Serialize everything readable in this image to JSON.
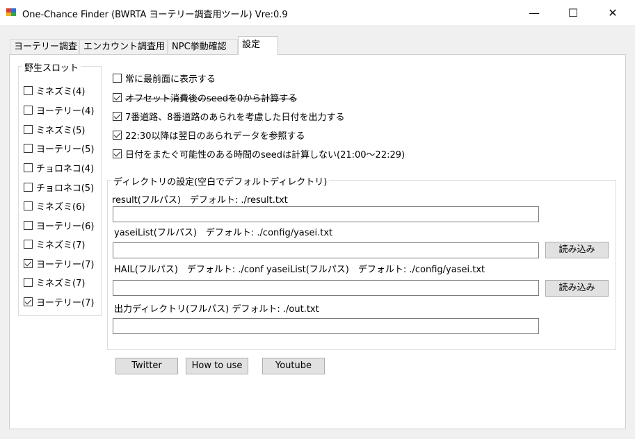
{
  "window": {
    "title": "One-Chance Finder (BWRTA ヨーテリー調査用ツール) Vre:0.9",
    "minimize": "—",
    "maximize": "☐",
    "close": "✕"
  },
  "tabs": [
    {
      "label": "ヨーテリー調査",
      "active": false
    },
    {
      "label": "エンカウント調査用",
      "active": false
    },
    {
      "label": "NPC挙動確認",
      "active": false
    },
    {
      "label": "設定",
      "active": true
    }
  ],
  "wild_slots": {
    "legend": "野生スロット",
    "items": [
      {
        "label": "ミネズミ(4)",
        "checked": false
      },
      {
        "label": "ヨーテリー(4)",
        "checked": false
      },
      {
        "label": "ミネズミ(5)",
        "checked": false
      },
      {
        "label": "ヨーテリー(5)",
        "checked": false
      },
      {
        "label": "チョロネコ(4)",
        "checked": false
      },
      {
        "label": "チョロネコ(5)",
        "checked": false
      },
      {
        "label": "ミネズミ(6)",
        "checked": false
      },
      {
        "label": "ヨーテリー(6)",
        "checked": false
      },
      {
        "label": "ミネズミ(7)",
        "checked": false
      },
      {
        "label": "ヨーテリー(7)",
        "checked": true
      },
      {
        "label": "ミネズミ(7)",
        "checked": false
      },
      {
        "label": "ヨーテリー(7)",
        "checked": true
      }
    ]
  },
  "options": [
    {
      "label": "常に最前面に表示する",
      "checked": false,
      "strike": false
    },
    {
      "label": "オフセット消費後のseedを0から計算する",
      "checked": true,
      "strike": true
    },
    {
      "label": "7番道路、8番道路のあられを考慮した日付を出力する",
      "checked": true,
      "strike": false
    },
    {
      "label": "22:30以降は翌日のあられデータを参照する",
      "checked": true,
      "strike": false
    },
    {
      "label": "日付をまたぐ可能性のある時間のseedは計算しない(21:00～22:29)",
      "checked": true,
      "strike": false
    }
  ],
  "directory": {
    "legend": "ディレクトリの設定(空白でデフォルトディレクトリ)",
    "result_label": "result(フルパス)　デフォルト: ./result.txt",
    "result_value": "",
    "yasei_label": "yaseiList(フルパス)　デフォルト: ./config/yasei.txt",
    "yasei_value": "",
    "hail_label": "HAIL(フルパス)　デフォルト: ./conf yaseiList(フルパス)　デフォルト: ./config/yasei.txt",
    "hail_value": "",
    "output_label": "出力ディレクトリ(フルパス)  デフォルト:  ./out.txt",
    "output_value": "",
    "load_button_1": "読み込み",
    "load_button_2": "読み込み"
  },
  "links": {
    "twitter": "Twitter",
    "howto": "How to use",
    "youtube": "Youtube"
  }
}
